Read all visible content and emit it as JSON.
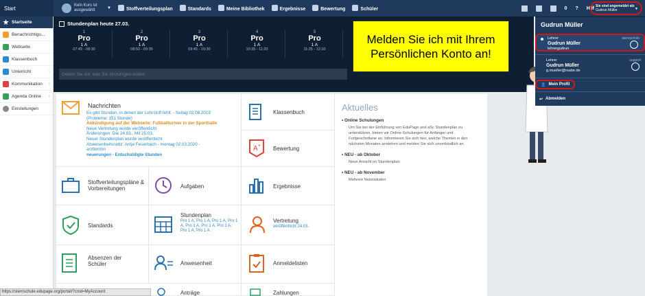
{
  "topbar": {
    "start": "Start",
    "course": "Kein Kurs ist ausgewählt",
    "nav": [
      "Stoffverteilungsplan",
      "Standards",
      "Meine Bibliothek",
      "Ergebnisse",
      "Bewertung",
      "Schüler"
    ],
    "badge": "0",
    "help": "Hilf",
    "logged_in_label": "Sie sind angemeldet als",
    "logged_in_user": "Gudrun Müller"
  },
  "sidebar": {
    "items": [
      {
        "label": "Startseite",
        "icon": "star-icon",
        "color": "#ffffff"
      },
      {
        "label": "Benachrichtigu...",
        "icon": "envelope-icon",
        "color": "#f0a030"
      },
      {
        "label": "Webseite",
        "icon": "globe-icon",
        "color": "#3aa055"
      },
      {
        "label": "Klassenbuch",
        "icon": "book-icon",
        "color": "#2a8bd0"
      },
      {
        "label": "Unterricht",
        "icon": "board-icon",
        "color": "#2a8bd0"
      },
      {
        "label": "Kommunikation",
        "icon": "chat-icon",
        "color": "#e04040"
      },
      {
        "label": "Agenda Online",
        "icon": "check-icon",
        "color": "#3aa055"
      },
      {
        "label": "Einstellungen",
        "icon": "gear-icon",
        "color": "#888888"
      }
    ]
  },
  "timetable": {
    "title": "Stundenplan heute 27.03.",
    "periods": [
      {
        "n": "1",
        "subject": "Pro",
        "class": "1 A",
        "time": "07:45 - 08:30"
      },
      {
        "n": "2",
        "subject": "Pro",
        "class": "1 A",
        "time": "08:50 - 09:35"
      },
      {
        "n": "3",
        "subject": "Pro",
        "class": "1 A",
        "time": "09:45 - 10:30"
      },
      {
        "n": "4",
        "subject": "Pro",
        "class": "1 A",
        "time": "10:35 - 11:20"
      },
      {
        "n": "5",
        "subject": "Pro",
        "class": "1 A",
        "time": "11:25 - 12:10"
      }
    ],
    "input_placeholder": "Geben Sie ein, was Sie hinzufügen wollen"
  },
  "callout": "Melden Sie ich mit Ihrem Persönlichen Konto an!",
  "tiles": {
    "nachrichten": {
      "label": "Nachrichten",
      "lines": [
        "Es gibt Stunden, in denen der Lehrstoff fehlt. - freitag 02.08.2019",
        "(Probleme: 151 Stunde)",
        "Ankündigung auf der Webseite: Fußballturnier in der Sporthalle",
        "Neue Vertretung wurde veröffentlicht",
        "Änderungen: Die 24.03., Mit 25.03.",
        "Neuer Stundenplan wurde veröffentlicht",
        "Abwesenheitsnotiz: Antje Feuerbach - montag 02.03.2020 -",
        "arzttermin",
        "neuerungen - Entschuldigte Stunden"
      ]
    },
    "klassenbuch": "Klassenbuch",
    "bewertung": "Bewertung",
    "stoff": "Stoffverteilungspläne & Vorbereitungen",
    "aufgaben": "Aufgaben",
    "ergebnisse": "Ergebnisse",
    "standards": "Standards",
    "stundenplan": "Stundenplan",
    "stundenplan_sub": "Pro 1 A, Pro 1 A, Pro 1 A, Pro 1 A, Pro 1 A, Pro 1 A, Pro 1 A, Pro 1 A, Pro 1 A",
    "vertretung": "Vertretung",
    "vertretung_sub": "veröffentlicht 24.03.",
    "absenzen": "Absenzen der Schüler",
    "anwesenheit": "Anwesenheit",
    "anmeldelisten": "Anmeldelisten",
    "antraege": "Anträge",
    "zahlungen": "Zahlungen"
  },
  "aktuelles": {
    "title": "Aktuelles",
    "items": [
      {
        "head": "Online Schulungen",
        "body": "Um Sie bei der Einführung von EduPage und aSc Stundenplan zu unterstützen, bieten wir Online-Schulungen für Anfänger und Fortgeschrittene an. Informieren Sie sich hier, welche Themen in den nächsten Monaten anstehen und melden Sie sich unverbindlich an."
      },
      {
        "head": "NEU - ab Oktober",
        "body": "Neue Ansicht im Stundenplan"
      },
      {
        "head": "NEU - ab November",
        "body": "Mehrere Notenskalen"
      }
    ]
  },
  "dropdown": {
    "header": "Gudrun Müller",
    "accounts": [
      {
        "role": "Lehrer",
        "name": "Gudrun Müller",
        "login": "lehrergudrun",
        "tag": "sternschule"
      },
      {
        "role": "Lehrer",
        "name": "Gudrun Müller",
        "login": "g.mueller@rsabe.de",
        "tag": "support"
      }
    ],
    "profile": "Mein Profil",
    "logout": "Abmelden"
  },
  "status_url": "https://sternschule.edupage.org/portal/?cmd=MyAccount"
}
